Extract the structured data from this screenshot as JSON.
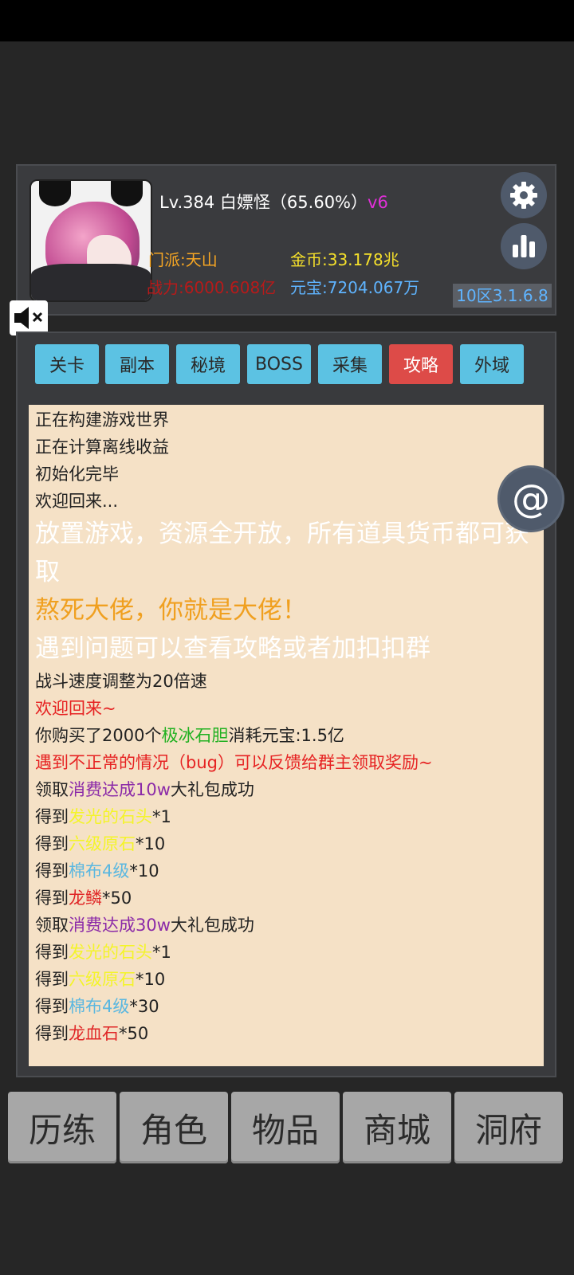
{
  "player": {
    "level_name": "Lv.384 白嫖怪（65.60%）",
    "vip": "v6",
    "sect": "门派:天山",
    "gold": "金币:33.178兆",
    "power": "战力:6000.608亿",
    "ingot": "元宝:7204.067万",
    "version": "10区3.1.6.8"
  },
  "tabs": [
    {
      "label": "关卡"
    },
    {
      "label": "副本"
    },
    {
      "label": "秘境"
    },
    {
      "label": "BOSS"
    },
    {
      "label": "采集"
    },
    {
      "label": "攻略",
      "active": true
    },
    {
      "label": "外域"
    }
  ],
  "log": [
    {
      "text": "正在构建游戏世界"
    },
    {
      "text": "正在计算离线收益"
    },
    {
      "text": "初始化完毕"
    },
    {
      "text": "欢迎回来..."
    },
    {
      "text": "放置游戏，资源全开放，所有道具货币都可获取"
    },
    {
      "text": "熬死大佬，你就是大佬！"
    },
    {
      "text": "遇到问题可以查看攻略或者加扣扣群"
    },
    {
      "text": "战斗速度调整为20倍速"
    },
    {
      "text": "欢迎回来~"
    },
    {
      "pre": "你购买了2000个",
      "item": "极冰石胆",
      "post": "消耗元宝:1.5亿"
    },
    {
      "text": "遇到不正常的情况（bug）可以反馈给群主领取奖励~"
    },
    {
      "pre": "领取",
      "item": "消费达成10w",
      "post": "大礼包成功"
    },
    {
      "pre": "得到",
      "item": "发光的石头",
      "post": "*1"
    },
    {
      "pre": "得到",
      "item": "六级原石",
      "post": "*10"
    },
    {
      "pre": "得到",
      "item": "棉布4级",
      "post": "*10"
    },
    {
      "pre": "得到",
      "item": "龙鳞",
      "post": "*50"
    },
    {
      "pre": "领取",
      "item": "消费达成30w",
      "post": "大礼包成功"
    },
    {
      "pre": "得到",
      "item": "发光的石头",
      "post": "*1"
    },
    {
      "pre": "得到",
      "item": "六级原石",
      "post": "*10"
    },
    {
      "pre": "得到",
      "item": "棉布4级",
      "post": "*30"
    },
    {
      "pre": "得到",
      "item": "龙血石",
      "post": "*50"
    }
  ],
  "nav": [
    {
      "label": "历练"
    },
    {
      "label": "角色"
    },
    {
      "label": "物品"
    },
    {
      "label": "商城"
    },
    {
      "label": "洞府"
    }
  ],
  "icons": {
    "settings": "gear-icon",
    "stats": "bar-chart-icon",
    "mute": "speaker-muted-icon",
    "at": "at-sign-icon"
  },
  "colors": {
    "tab": "#5cc2e3",
    "tab_active": "#dd4b48",
    "log_bg": "#f5e1c6"
  }
}
